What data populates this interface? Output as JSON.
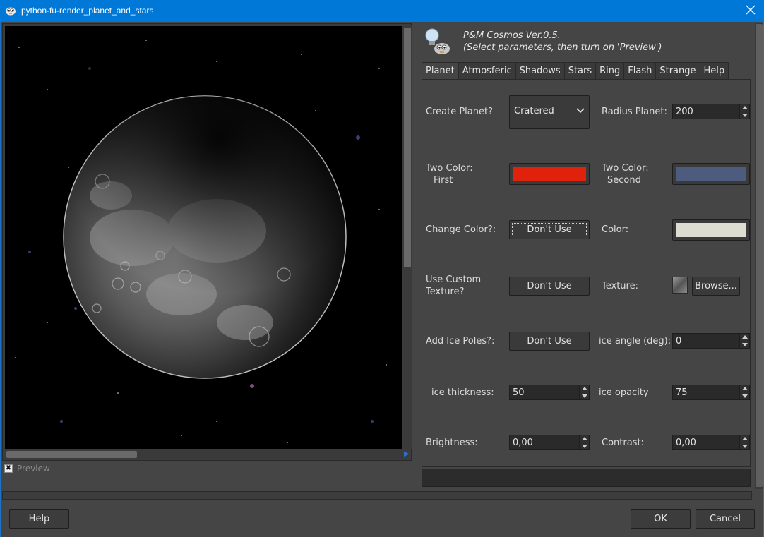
{
  "window": {
    "title": "python-fu-render_planet_and_stars"
  },
  "header": {
    "line1": "P&M Cosmos Ver.0.5.",
    "line2": "(Select parameters, then turn on 'Preview')"
  },
  "preview": {
    "label": "Preview",
    "checked": true,
    "check_glyph": "✖"
  },
  "tabs": [
    {
      "label": "Planet",
      "active": true
    },
    {
      "label": "Atmosferic"
    },
    {
      "label": "Shadows"
    },
    {
      "label": "Stars"
    },
    {
      "label": "Ring"
    },
    {
      "label": "Flash"
    },
    {
      "label": "Strange"
    },
    {
      "label": "Help"
    }
  ],
  "planet": {
    "create_planet_label": "Create Planet?",
    "create_planet_value": "Cratered",
    "radius_label": "Radius Planet:",
    "radius_value": "200",
    "two_color_first_label": "Two Color:",
    "two_color_first_sub": "First",
    "two_color_first_color": "#e0220d",
    "two_color_second_label": "Two Color:",
    "two_color_second_sub": "Second",
    "two_color_second_color": "#4d5b7e",
    "change_color_label": "Change Color?:",
    "change_color_button": "Don't Use",
    "color_label": "Color:",
    "color_value": "#dcdcd0",
    "custom_texture_label_1": "Use Custom",
    "custom_texture_label_2": "Texture?",
    "custom_texture_button": "Don't Use",
    "texture_label": "Texture:",
    "browse_button": "Browse...",
    "ice_poles_label": "Add Ice Poles?:",
    "ice_poles_button": "Don't Use",
    "ice_angle_label": "ice angle (deg):",
    "ice_angle_value": "0",
    "ice_thickness_label": "ice thickness:",
    "ice_thickness_value": "50",
    "ice_opacity_label": "ice opacity",
    "ice_opacity_value": "75",
    "brightness_label": "Brightness:",
    "brightness_value": "0,00",
    "contrast_label": "Contrast:",
    "contrast_value": "0,00"
  },
  "footer": {
    "help": "Help",
    "ok": "OK",
    "cancel": "Cancel"
  },
  "colors": {
    "titlebar": "#0078d7",
    "window_bg": "#454545"
  },
  "icons": {
    "app": "gimp-icon",
    "close": "close-icon",
    "header": "lightbulb-icon",
    "combo": "chevron-down-icon",
    "texture": "texture-thumbnail-icon"
  }
}
